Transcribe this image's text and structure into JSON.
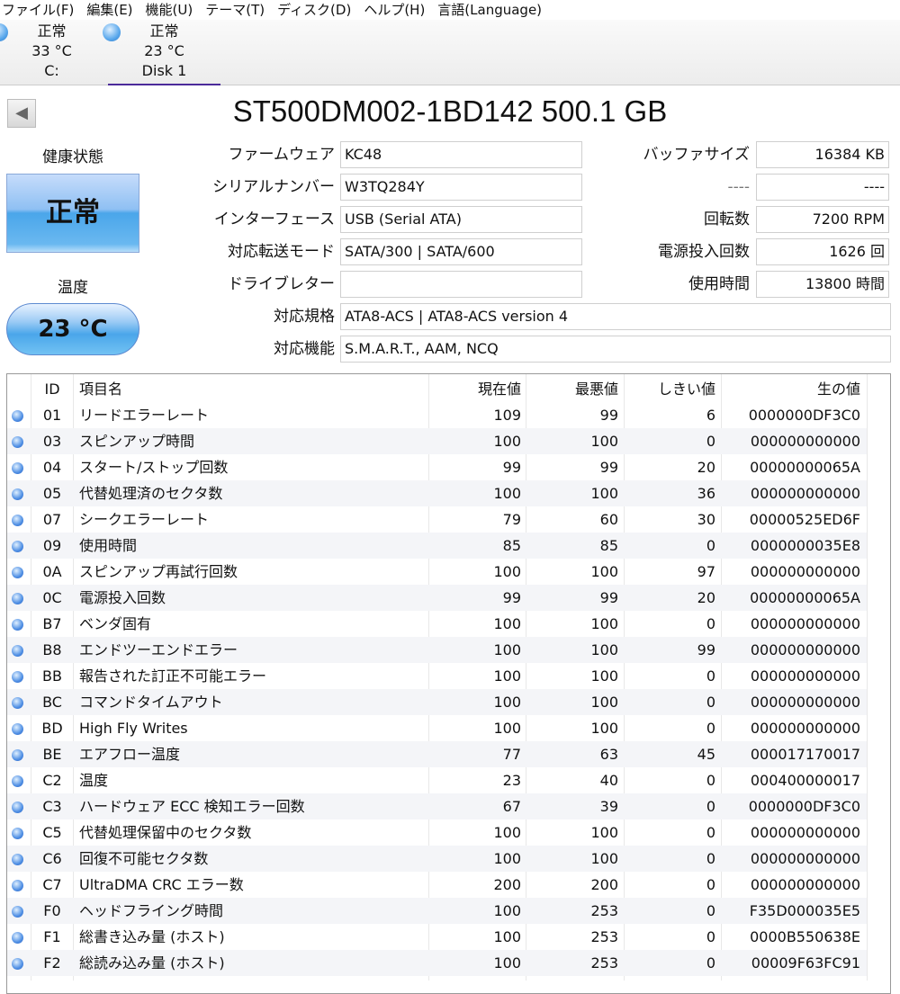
{
  "menu": [
    "ファイル(F)",
    "編集(E)",
    "機能(U)",
    "テーマ(T)",
    "ディスク(D)",
    "ヘルプ(H)",
    "言語(Language)"
  ],
  "disks": [
    {
      "status": "正常",
      "temp": "33 °C",
      "name": "C:"
    },
    {
      "status": "正常",
      "temp": "23 °C",
      "name": "Disk 1"
    }
  ],
  "title": "ST500DM002-1BD142 500.1 GB",
  "health": {
    "label": "健康状態",
    "value": "正常"
  },
  "temperature": {
    "label": "温度",
    "value": "23 °C"
  },
  "info": {
    "firmware_label": "ファームウェア",
    "firmware": "KC48",
    "serial_label": "シリアルナンバー",
    "serial": "W3TQ284Y",
    "interface_label": "インターフェース",
    "interface": "USB (Serial ATA)",
    "transfer_label": "対応転送モード",
    "transfer": "SATA/300 | SATA/600",
    "drive_letter_label": "ドライブレター",
    "drive_letter": "",
    "standard_label": "対応規格",
    "standard": "ATA8-ACS | ATA8-ACS version 4",
    "features_label": "対応機能",
    "features": "S.M.A.R.T., AAM, NCQ",
    "buffer_label": "バッファサイズ",
    "buffer": "16384 KB",
    "blank_label": "----",
    "blank": "----",
    "rpm_label": "回転数",
    "rpm": "7200 RPM",
    "power_count_label": "電源投入回数",
    "power_count": "1626 回",
    "hours_label": "使用時間",
    "hours": "13800 時間"
  },
  "table": {
    "headers": {
      "id": "ID",
      "name": "項目名",
      "cur": "現在値",
      "worst": "最悪値",
      "thr": "しきい値",
      "raw": "生の値"
    },
    "rows": [
      {
        "id": "01",
        "name": "リードエラーレート",
        "cur": "109",
        "worst": "99",
        "thr": "6",
        "raw": "0000000DF3C0"
      },
      {
        "id": "03",
        "name": "スピンアップ時間",
        "cur": "100",
        "worst": "100",
        "thr": "0",
        "raw": "000000000000"
      },
      {
        "id": "04",
        "name": "スタート/ストップ回数",
        "cur": "99",
        "worst": "99",
        "thr": "20",
        "raw": "00000000065A"
      },
      {
        "id": "05",
        "name": "代替処理済のセクタ数",
        "cur": "100",
        "worst": "100",
        "thr": "36",
        "raw": "000000000000"
      },
      {
        "id": "07",
        "name": "シークエラーレート",
        "cur": "79",
        "worst": "60",
        "thr": "30",
        "raw": "00000525ED6F"
      },
      {
        "id": "09",
        "name": "使用時間",
        "cur": "85",
        "worst": "85",
        "thr": "0",
        "raw": "0000000035E8"
      },
      {
        "id": "0A",
        "name": "スピンアップ再試行回数",
        "cur": "100",
        "worst": "100",
        "thr": "97",
        "raw": "000000000000"
      },
      {
        "id": "0C",
        "name": "電源投入回数",
        "cur": "99",
        "worst": "99",
        "thr": "20",
        "raw": "00000000065A"
      },
      {
        "id": "B7",
        "name": "ベンダ固有",
        "cur": "100",
        "worst": "100",
        "thr": "0",
        "raw": "000000000000"
      },
      {
        "id": "B8",
        "name": "エンドツーエンドエラー",
        "cur": "100",
        "worst": "100",
        "thr": "99",
        "raw": "000000000000"
      },
      {
        "id": "BB",
        "name": "報告された訂正不可能エラー",
        "cur": "100",
        "worst": "100",
        "thr": "0",
        "raw": "000000000000"
      },
      {
        "id": "BC",
        "name": "コマンドタイムアウト",
        "cur": "100",
        "worst": "100",
        "thr": "0",
        "raw": "000000000000"
      },
      {
        "id": "BD",
        "name": "High Fly Writes",
        "cur": "100",
        "worst": "100",
        "thr": "0",
        "raw": "000000000000"
      },
      {
        "id": "BE",
        "name": "エアフロー温度",
        "cur": "77",
        "worst": "63",
        "thr": "45",
        "raw": "000017170017"
      },
      {
        "id": "C2",
        "name": "温度",
        "cur": "23",
        "worst": "40",
        "thr": "0",
        "raw": "000400000017"
      },
      {
        "id": "C3",
        "name": "ハードウェア ECC 検知エラー回数",
        "cur": "67",
        "worst": "39",
        "thr": "0",
        "raw": "0000000DF3C0"
      },
      {
        "id": "C5",
        "name": "代替処理保留中のセクタ数",
        "cur": "100",
        "worst": "100",
        "thr": "0",
        "raw": "000000000000"
      },
      {
        "id": "C6",
        "name": "回復不可能セクタ数",
        "cur": "100",
        "worst": "100",
        "thr": "0",
        "raw": "000000000000"
      },
      {
        "id": "C7",
        "name": "UltraDMA CRC エラー数",
        "cur": "200",
        "worst": "200",
        "thr": "0",
        "raw": "000000000000"
      },
      {
        "id": "F0",
        "name": "ヘッドフライング時間",
        "cur": "100",
        "worst": "253",
        "thr": "0",
        "raw": "F35D000035E5"
      },
      {
        "id": "F1",
        "name": "総書き込み量 (ホスト)",
        "cur": "100",
        "worst": "253",
        "thr": "0",
        "raw": "0000B550638E"
      },
      {
        "id": "F2",
        "name": "総読み込み量 (ホスト)",
        "cur": "100",
        "worst": "253",
        "thr": "0",
        "raw": "00009F63FC91"
      }
    ]
  }
}
